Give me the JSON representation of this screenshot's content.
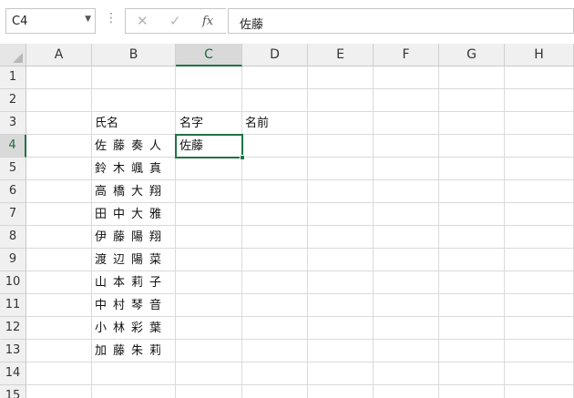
{
  "formula_bar": {
    "name_box": "C4",
    "name_box_arrow": "▼",
    "cancel": "✕",
    "enter": "✓",
    "fx": "fx",
    "value": "佐藤"
  },
  "columns": [
    "A",
    "B",
    "C",
    "D",
    "E",
    "F",
    "G",
    "H"
  ],
  "rows": [
    "1",
    "2",
    "3",
    "4",
    "5",
    "6",
    "7",
    "8",
    "9",
    "10",
    "11",
    "12",
    "13",
    "14",
    "15"
  ],
  "headers": {
    "b3": "氏名",
    "c3": "名字",
    "d3": "名前"
  },
  "names": [
    "佐藤奏人",
    "鈴木颯真",
    "高橋大翔",
    "田中大雅",
    "伊藤陽翔",
    "渡辺陽菜",
    "山本莉子",
    "中村琴音",
    "小林彩葉",
    "加藤朱莉"
  ],
  "active_cell_value": "佐藤",
  "colors": {
    "accent": "#217346",
    "header_bg": "#f0f0f0",
    "selected_header_bg": "#d9d9d9"
  }
}
